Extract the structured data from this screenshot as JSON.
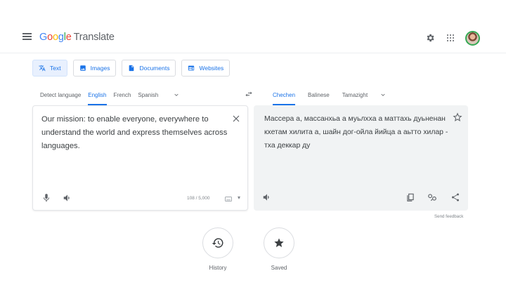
{
  "header": {
    "logo_letters": [
      "G",
      "o",
      "o",
      "g",
      "l",
      "e"
    ],
    "product": "Translate",
    "icons": [
      "menu-icon",
      "settings-icon",
      "apps-icon",
      "avatar"
    ]
  },
  "tabs": [
    {
      "label": "Text",
      "icon": "translate-icon",
      "active": true
    },
    {
      "label": "Images",
      "icon": "image-icon",
      "active": false
    },
    {
      "label": "Documents",
      "icon": "document-icon",
      "active": false
    },
    {
      "label": "Websites",
      "icon": "website-icon",
      "active": false
    }
  ],
  "source_langs": [
    "Detect language",
    "English",
    "French",
    "Spanish"
  ],
  "source_selected": "English",
  "target_langs": [
    "Chechen",
    "Balinese",
    "Tamazight"
  ],
  "target_selected": "Chechen",
  "source": {
    "text": "Our mission: to enable everyone, everywhere to understand the world and express themselves across languages.",
    "char_count": "108 / 5,000"
  },
  "target": {
    "text": "Массера а, массанхьа а муьлхха а маттахь дуьненан кхетам хилита а, шайн дог-ойла йийца а аьтто хилар - тха деккар ду"
  },
  "feedback": "Send feedback",
  "bottom": {
    "history_label": "History",
    "saved_label": "Saved"
  },
  "colors": {
    "accent": "#1a73e8",
    "panel_bg": "#f1f3f4",
    "text": "#3c4043"
  }
}
